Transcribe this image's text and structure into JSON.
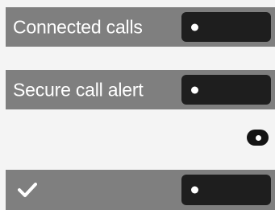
{
  "settings": {
    "connected_calls": {
      "label": "Connected calls",
      "state": "on"
    },
    "secure_call_alert": {
      "label": "Secure call alert",
      "state": "on"
    },
    "unlabeled_toggle": {
      "state": "on"
    },
    "checked_row": {
      "icon": "checkmark-icon",
      "state": "on"
    }
  },
  "colors": {
    "row_background": "#7f7f7f",
    "page_background": "#f4f4f4",
    "toggle_background": "#1e1e1e",
    "text": "#ffffff"
  }
}
